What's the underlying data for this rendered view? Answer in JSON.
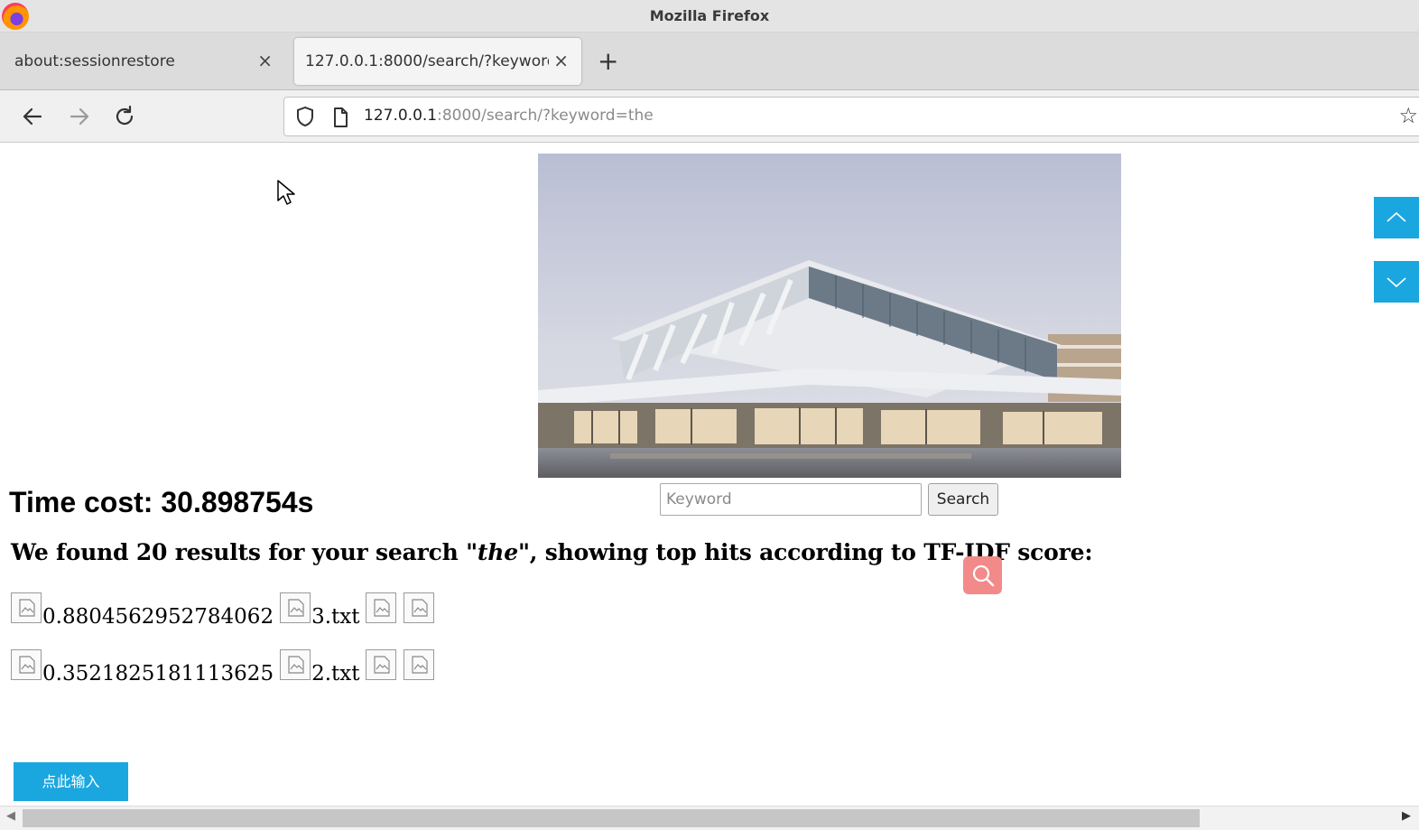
{
  "window": {
    "title": "Mozilla Firefox"
  },
  "tabs": [
    {
      "label": "about:sessionrestore",
      "active": false
    },
    {
      "label": "127.0.0.1:8000/search/?keyword=the",
      "active": true
    }
  ],
  "toolbar": {
    "url_host": "127.0.0.1",
    "url_rest": ":8000/search/?keyword=the"
  },
  "search": {
    "placeholder": "Keyword",
    "value": "",
    "button_label": "Search"
  },
  "time_cost": "Time cost: 30.898754s",
  "results_heading": {
    "prefix": "We found 20 results for your search \"",
    "keyword": "the",
    "suffix": "\", showing top hits according to TF-IDF score:"
  },
  "results": [
    {
      "score": "0.8804562952784062",
      "file": "3.txt"
    },
    {
      "score": "0.3521825181113625",
      "file": "2.txt"
    }
  ],
  "input_button_label": "点此输入",
  "colors": {
    "accent_blue": "#1aa7e0",
    "float_search": "#f28a8a"
  },
  "icons": [
    "firefox-logo",
    "close-icon",
    "plus-icon",
    "back-arrow-icon",
    "forward-arrow-icon",
    "reload-icon",
    "shield-icon",
    "page-icon",
    "star-icon",
    "broken-image-icon",
    "magnifier-icon",
    "chevron-up-icon",
    "chevron-down-icon"
  ]
}
